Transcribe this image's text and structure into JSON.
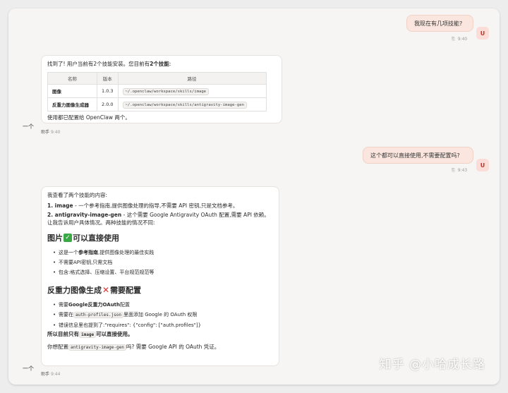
{
  "messages": {
    "q1": {
      "text": "我现在有几项技能?",
      "avatar": "U",
      "time": "9:40",
      "copy_icon": "copy-icon"
    },
    "a1": {
      "intro_prefix": "找到了! 用户当前有2个技能安装。您目前有",
      "intro_bold": "2个技能",
      "intro_suffix": ":",
      "table": {
        "headers": [
          "名称",
          "版本",
          "路径"
        ],
        "rows": [
          {
            "name": "图像",
            "version": "1.0.3",
            "path": "~/.openclaw/workspace/skills/image"
          },
          {
            "name": "反重力图像生成器",
            "version": "2.0.0",
            "path": "~/.openclaw/workspace/skills/antigravity-image-gen"
          }
        ]
      },
      "footer": "使用都已配置给 OpenClaw 两个。",
      "side_label": "一个",
      "author": "助手",
      "time": "9:40"
    },
    "q2": {
      "text": "这个都可以直接使用,不需要配置吗?",
      "avatar": "U",
      "time": "9:43",
      "copy_icon": "copy-icon"
    },
    "a2": {
      "intro": "我查看了两个技能的内容:",
      "item1_bold": "1. image",
      "item1_rest": " - 一个参考指南,提供图像处理的指导,不需要 API 密钥,只是文档参考。",
      "item2_bold": "2. antigravity-image-gen",
      "item2_rest": " - 这个需要 Google Antigravity OAuth 配置,需要 API 依赖。",
      "item2_tail": "让我告诉用户具体情况。两种技能的情况不同:",
      "sec1_title_a": "图片",
      "sec1_title_b": "可以直接使用",
      "sec1_bullets": [
        {
          "pre": "这是一个",
          "bold": "参考指南",
          "post": ",提供图像处理的最佳实践"
        },
        {
          "pre": "不需要API密钥,只需文档",
          "bold": "",
          "post": ""
        },
        {
          "pre": "包含:格式选择、压缩设置、平台规范规范等",
          "bold": "",
          "post": ""
        }
      ],
      "sec2_title_a": "反重力图像生成",
      "sec2_title_b": "需要配置",
      "sec2_b1_pre": "需要",
      "sec2_b1_bold": "Google反重力OAuth",
      "sec2_b1_post": "配置",
      "sec2_b2_pre": "需要在",
      "sec2_b2_code": "auth-profiles.json",
      "sec2_b2_post": "里面添加 Google 的 OAuth 权限",
      "sec2_b3": "错误信息里也提到了:\"requires\": {\"config\": [\"auth.profiles\"]}",
      "sec2_b4_pre": "所以目前只有",
      "sec2_b4_code": "image",
      "sec2_b4_post": "可以直接使用。",
      "closing_pre": "你想配置",
      "closing_code": "antigravity-image-gen",
      "closing_post": "吗? 需要 Google API 的 OAuth 凭证。",
      "side_label": "一个",
      "author": "助手",
      "time": "9:44"
    }
  },
  "watermark": "知乎 @小哈成长路",
  "colors": {
    "user_bubble": "#fae6de",
    "avatar_text": "#c0392b",
    "check": "#3aa845",
    "cross": "#e0312d"
  }
}
